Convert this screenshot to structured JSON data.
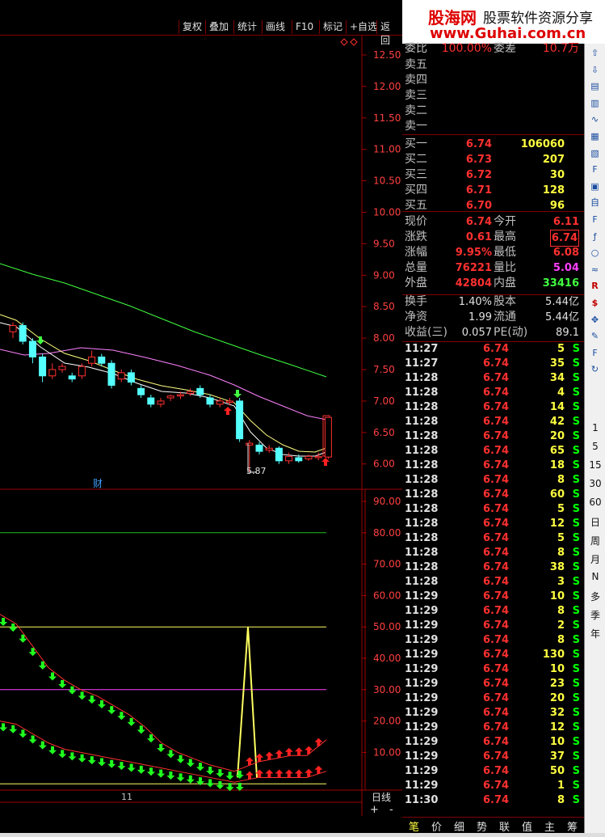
{
  "toolbar": {
    "items": [
      "复权",
      "叠加",
      "统计",
      "画线",
      "F10",
      "标记",
      "+自选",
      "返回"
    ]
  },
  "watermark": {
    "logo": "股海网",
    "text": "股票软件资源分享",
    "url": "www.Guhai.com.cn"
  },
  "price_axis": [
    "12.50",
    "12.00",
    "11.50",
    "11.00",
    "10.50",
    "10.00",
    "9.50",
    "9.00",
    "8.50",
    "8.00",
    "7.50",
    "7.00",
    "6.50",
    "6.00"
  ],
  "ind_axis": [
    "90.00",
    "80.00",
    "70.00",
    "60.00",
    "50.00",
    "40.00",
    "30.00",
    "20.00",
    "10.00"
  ],
  "chart_labels": {
    "low_marker": "5.87",
    "cai": "财",
    "date_mark": "11",
    "period": "日线",
    "plus": "+",
    "minus": "-"
  },
  "colors": {
    "up": "#ff3030",
    "down": "#54ffff",
    "ma1": "#ffffff",
    "ma2": "#ffff80",
    "ma3": "#ff80ff",
    "ma4": "#40ff40",
    "arrow_up": "#ff2020",
    "arrow_down": "#20ff20"
  },
  "quote": {
    "header": {
      "a": "委比",
      "b": "100.00%",
      "c": "委差",
      "d": "10.7万"
    },
    "sells": [
      "卖五",
      "卖四",
      "卖三",
      "卖二",
      "卖一"
    ],
    "buys": [
      {
        "label": "买一",
        "price": "6.74",
        "vol": "106060"
      },
      {
        "label": "买二",
        "price": "6.73",
        "vol": "207"
      },
      {
        "label": "买三",
        "price": "6.72",
        "vol": "30"
      },
      {
        "label": "买四",
        "price": "6.71",
        "vol": "128"
      },
      {
        "label": "买五",
        "price": "6.70",
        "vol": "96"
      }
    ],
    "stats": [
      {
        "l1": "现价",
        "v1": "6.74",
        "l2": "今开",
        "v2": "6.11",
        "c2": "#ff3030"
      },
      {
        "l1": "涨跌",
        "v1": "0.61",
        "l2": "最高",
        "v2": "6.74",
        "c2": "#ff3030"
      },
      {
        "l1": "涨幅",
        "v1": "9.95%",
        "l2": "最低",
        "v2": "6.08",
        "c2": "#ff3030"
      },
      {
        "l1": "总量",
        "v1": "76221",
        "l2": "量比",
        "v2": "5.04",
        "c2": "#ff40ff"
      },
      {
        "l1": "外盘",
        "v1": "42804",
        "l2": "内盘",
        "v2": "33416",
        "c2": "#40ff40"
      }
    ],
    "extra": [
      {
        "l1": "换手",
        "v1": "1.40%",
        "l2": "股本",
        "v2": "5.44亿"
      },
      {
        "l1": "净资",
        "v1": "1.99",
        "l2": "流通",
        "v2": "5.44亿"
      },
      {
        "l1": "收益(三)",
        "v1": "0.057",
        "l2": "PE(动)",
        "v2": "89.1"
      }
    ]
  },
  "ticks": [
    [
      "11:27",
      "6.74",
      "5",
      "S"
    ],
    [
      "11:27",
      "6.74",
      "35",
      "S"
    ],
    [
      "11:28",
      "6.74",
      "34",
      "S"
    ],
    [
      "11:28",
      "6.74",
      "4",
      "S"
    ],
    [
      "11:28",
      "6.74",
      "14",
      "S"
    ],
    [
      "11:28",
      "6.74",
      "42",
      "S"
    ],
    [
      "11:28",
      "6.74",
      "20",
      "S"
    ],
    [
      "11:28",
      "6.74",
      "65",
      "S"
    ],
    [
      "11:28",
      "6.74",
      "18",
      "S"
    ],
    [
      "11:28",
      "6.74",
      "8",
      "S"
    ],
    [
      "11:28",
      "6.74",
      "60",
      "S"
    ],
    [
      "11:28",
      "6.74",
      "5",
      "S"
    ],
    [
      "11:28",
      "6.74",
      "12",
      "S"
    ],
    [
      "11:28",
      "6.74",
      "5",
      "S"
    ],
    [
      "11:28",
      "6.74",
      "8",
      "S"
    ],
    [
      "11:28",
      "6.74",
      "38",
      "S"
    ],
    [
      "11:28",
      "6.74",
      "3",
      "S"
    ],
    [
      "11:29",
      "6.74",
      "10",
      "S"
    ],
    [
      "11:29",
      "6.74",
      "8",
      "S"
    ],
    [
      "11:29",
      "6.74",
      "2",
      "S"
    ],
    [
      "11:29",
      "6.74",
      "8",
      "S"
    ],
    [
      "11:29",
      "6.74",
      "130",
      "S"
    ],
    [
      "11:29",
      "6.74",
      "10",
      "S"
    ],
    [
      "11:29",
      "6.74",
      "23",
      "S"
    ],
    [
      "11:29",
      "6.74",
      "20",
      "S"
    ],
    [
      "11:29",
      "6.74",
      "32",
      "S"
    ],
    [
      "11:29",
      "6.74",
      "12",
      "S"
    ],
    [
      "11:29",
      "6.74",
      "10",
      "S"
    ],
    [
      "11:29",
      "6.74",
      "37",
      "S"
    ],
    [
      "11:29",
      "6.74",
      "50",
      "S"
    ],
    [
      "11:29",
      "6.74",
      "1",
      "S"
    ],
    [
      "11:30",
      "6.74",
      "8",
      "S"
    ]
  ],
  "bottom_tabs": [
    "笔",
    "价",
    "细",
    "势",
    "联",
    "值",
    "主",
    "筹"
  ],
  "side_text": [
    "1",
    "5",
    "15",
    "30",
    "60",
    "日",
    "周",
    "月",
    "N",
    "多",
    "季",
    "年"
  ],
  "side_icons": [
    "arrow-up-icon",
    "arrow-down-icon",
    "list-icon",
    "bar-icon",
    "line-icon",
    "kline-icon",
    "chart-icon",
    "f10-icon",
    "report-icon",
    "self-icon",
    "fz-icon",
    "fx-icon",
    "circle-icon",
    "wave-icon",
    "rsi-icon",
    "dollar-icon",
    "move-icon",
    "pen-icon",
    "f5-icon",
    "refresh-icon"
  ],
  "candles": [
    {
      "o": 8.1,
      "c": 8.2,
      "h": 8.25,
      "l": 8.0
    },
    {
      "o": 8.2,
      "c": 7.95,
      "h": 8.25,
      "l": 7.9
    },
    {
      "o": 7.95,
      "c": 7.7,
      "h": 8.0,
      "l": 7.6
    },
    {
      "o": 7.7,
      "c": 7.4,
      "h": 7.75,
      "l": 7.3
    },
    {
      "o": 7.4,
      "c": 7.5,
      "h": 7.6,
      "l": 7.35
    },
    {
      "o": 7.5,
      "c": 7.55,
      "h": 7.6,
      "l": 7.45
    },
    {
      "o": 7.4,
      "c": 7.35,
      "h": 7.45,
      "l": 7.3
    },
    {
      "o": 7.4,
      "c": 7.55,
      "h": 7.6,
      "l": 7.35
    },
    {
      "o": 7.6,
      "c": 7.7,
      "h": 7.8,
      "l": 7.55
    },
    {
      "o": 7.7,
      "c": 7.6,
      "h": 7.75,
      "l": 7.55
    },
    {
      "o": 7.6,
      "c": 7.25,
      "h": 7.65,
      "l": 7.2
    },
    {
      "o": 7.35,
      "c": 7.45,
      "h": 7.5,
      "l": 7.3
    },
    {
      "o": 7.45,
      "c": 7.3,
      "h": 7.5,
      "l": 7.25
    },
    {
      "o": 7.2,
      "c": 7.1,
      "h": 7.25,
      "l": 7.05
    },
    {
      "o": 7.05,
      "c": 6.95,
      "h": 7.1,
      "l": 6.9
    },
    {
      "o": 6.95,
      "c": 7.0,
      "h": 7.05,
      "l": 6.9
    },
    {
      "o": 7.05,
      "c": 7.08,
      "h": 7.1,
      "l": 7.0
    },
    {
      "o": 7.08,
      "c": 7.1,
      "h": 7.15,
      "l": 7.03
    },
    {
      "o": 7.12,
      "c": 7.15,
      "h": 7.2,
      "l": 7.08
    },
    {
      "o": 7.2,
      "c": 7.1,
      "h": 7.25,
      "l": 7.05
    },
    {
      "o": 7.05,
      "c": 6.95,
      "h": 7.1,
      "l": 6.9
    },
    {
      "o": 6.95,
      "c": 7.0,
      "h": 7.05,
      "l": 6.9
    },
    {
      "o": 6.98,
      "c": 7.0,
      "h": 7.05,
      "l": 6.93
    },
    {
      "o": 7.0,
      "c": 6.4,
      "h": 7.05,
      "l": 6.35
    },
    {
      "o": 6.3,
      "c": 6.33,
      "h": 6.38,
      "l": 5.87
    },
    {
      "o": 6.3,
      "c": 6.2,
      "h": 6.35,
      "l": 6.15
    },
    {
      "o": 6.22,
      "c": 6.25,
      "h": 6.3,
      "l": 6.18
    },
    {
      "o": 6.25,
      "c": 6.05,
      "h": 6.28,
      "l": 6.0
    },
    {
      "o": 6.05,
      "c": 6.12,
      "h": 6.18,
      "l": 6.0
    },
    {
      "o": 6.1,
      "c": 6.05,
      "h": 6.15,
      "l": 6.02
    },
    {
      "o": 6.08,
      "c": 6.12,
      "h": 6.15,
      "l": 6.05
    },
    {
      "o": 6.1,
      "c": 6.12,
      "h": 6.18,
      "l": 6.06
    },
    {
      "o": 6.11,
      "c": 6.74,
      "h": 6.74,
      "l": 6.08
    }
  ]
}
